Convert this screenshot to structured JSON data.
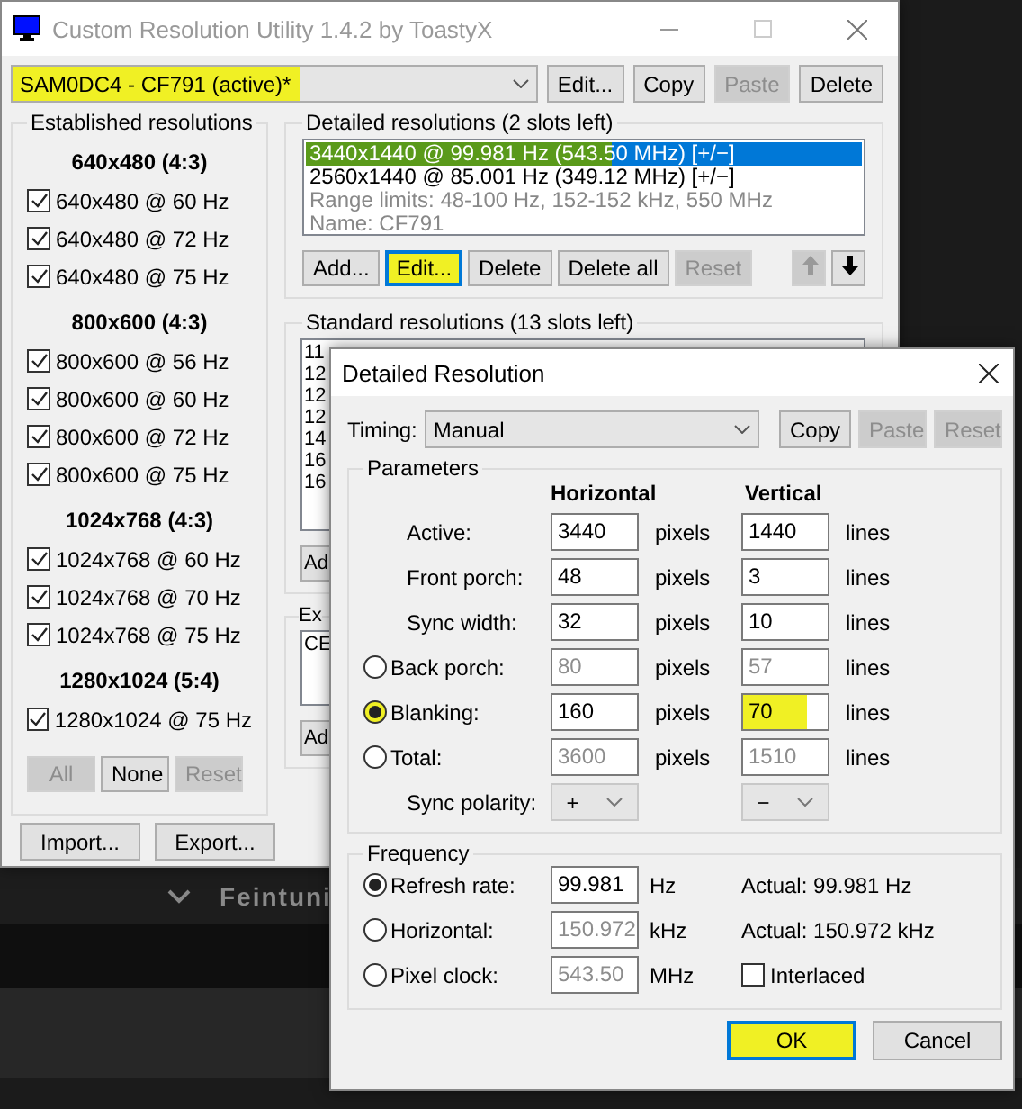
{
  "main_window": {
    "title": "Custom Resolution Utility 1.4.2 by ToastyX",
    "device": {
      "value": "SAM0DC4 - CF791 (active)*",
      "highlighted": true
    },
    "device_buttons": [
      {
        "label": "Edit...",
        "disabled": false
      },
      {
        "label": "Copy",
        "disabled": false
      },
      {
        "label": "Paste",
        "disabled": true
      },
      {
        "label": "Delete",
        "disabled": false
      }
    ],
    "established": {
      "title": "Established resolutions",
      "groups": [
        {
          "heading": "640x480 (4:3)",
          "items": [
            {
              "label": "640x480 @ 60 Hz",
              "checked": true
            },
            {
              "label": "640x480 @ 72 Hz",
              "checked": true
            },
            {
              "label": "640x480 @ 75 Hz",
              "checked": true
            }
          ]
        },
        {
          "heading": "800x600 (4:3)",
          "items": [
            {
              "label": "800x600 @ 56 Hz",
              "checked": true
            },
            {
              "label": "800x600 @ 60 Hz",
              "checked": true
            },
            {
              "label": "800x600 @ 72 Hz",
              "checked": true
            },
            {
              "label": "800x600 @ 75 Hz",
              "checked": true
            }
          ]
        },
        {
          "heading": "1024x768 (4:3)",
          "items": [
            {
              "label": "1024x768 @ 60 Hz",
              "checked": true
            },
            {
              "label": "1024x768 @ 70 Hz",
              "checked": true
            },
            {
              "label": "1024x768 @ 75 Hz",
              "checked": true
            }
          ]
        },
        {
          "heading": "1280x1024 (5:4)",
          "items": [
            {
              "label": "1280x1024 @ 75 Hz",
              "checked": true
            }
          ]
        }
      ],
      "buttons": [
        {
          "label": "All",
          "disabled": true
        },
        {
          "label": "None",
          "disabled": false
        },
        {
          "label": "Reset",
          "disabled": true
        }
      ]
    },
    "file_buttons": [
      {
        "label": "Import..."
      },
      {
        "label": "Export..."
      }
    ],
    "detailed": {
      "title": "Detailed resolutions (2 slots left)",
      "entries": [
        {
          "text": "3440x1440 @ 99.981 Hz (543.50 MHz) [+/−]",
          "kind": "resolution",
          "selected": true,
          "highlighted": true
        },
        {
          "text": "2560x1440 @ 85.001 Hz (349.12 MHz) [+/−]",
          "kind": "resolution",
          "selected": false,
          "highlighted": false
        },
        {
          "text": "Range limits: 48-100 Hz, 152-152 kHz, 550 MHz",
          "kind": "info",
          "selected": false,
          "highlighted": false
        },
        {
          "text": "Name: CF791",
          "kind": "info",
          "selected": false,
          "highlighted": false
        }
      ],
      "buttons": [
        {
          "label": "Add...",
          "disabled": false,
          "highlighted": false
        },
        {
          "label": "Edit...",
          "disabled": false,
          "highlighted": true
        },
        {
          "label": "Delete",
          "disabled": false,
          "highlighted": false
        },
        {
          "label": "Delete all",
          "disabled": false,
          "highlighted": false
        },
        {
          "label": "Reset",
          "disabled": true,
          "highlighted": false
        }
      ],
      "arrows": [
        {
          "kind": "up",
          "disabled": true
        },
        {
          "kind": "down",
          "disabled": false
        }
      ]
    },
    "standard": {
      "title": "Standard resolutions (13 slots left)",
      "entries": [
        "11",
        "12",
        "12",
        "12",
        "14",
        "16",
        "16"
      ],
      "button": "Ad"
    },
    "extension": {
      "title": "Ex",
      "entries": [
        "CE"
      ],
      "button": "Ad"
    }
  },
  "background": {
    "label": "Feintuni"
  },
  "dialog": {
    "title": "Detailed Resolution",
    "timing": {
      "label": "Timing:",
      "value": "Manual"
    },
    "timing_buttons": [
      {
        "label": "Copy",
        "disabled": false
      },
      {
        "label": "Paste",
        "disabled": true
      },
      {
        "label": "Reset",
        "disabled": true
      }
    ],
    "parameters": {
      "title": "Parameters",
      "headers": [
        "Horizontal",
        "Vertical"
      ],
      "rows": [
        {
          "kind": "plain",
          "label": "Active:",
          "horizontal": {
            "value": "3440",
            "disabled": false,
            "highlighted": false
          },
          "h_unit": "pixels",
          "vertical": {
            "value": "1440",
            "disabled": false,
            "highlighted": false
          },
          "v_unit": "lines"
        },
        {
          "kind": "plain",
          "label": "Front porch:",
          "horizontal": {
            "value": "48",
            "disabled": false,
            "highlighted": false
          },
          "h_unit": "pixels",
          "vertical": {
            "value": "3",
            "disabled": false,
            "highlighted": false
          },
          "v_unit": "lines"
        },
        {
          "kind": "plain",
          "label": "Sync width:",
          "horizontal": {
            "value": "32",
            "disabled": false,
            "highlighted": false
          },
          "h_unit": "pixels",
          "vertical": {
            "value": "10",
            "disabled": false,
            "highlighted": false
          },
          "v_unit": "lines"
        },
        {
          "kind": "radio",
          "label": "Back porch:",
          "selected": false,
          "highlighted": false,
          "horizontal": {
            "value": "80",
            "disabled": true,
            "highlighted": false
          },
          "h_unit": "pixels",
          "vertical": {
            "value": "57",
            "disabled": true,
            "highlighted": false
          },
          "v_unit": "lines"
        },
        {
          "kind": "radio",
          "label": "Blanking:",
          "selected": true,
          "highlighted": true,
          "horizontal": {
            "value": "160",
            "disabled": false,
            "highlighted": false
          },
          "h_unit": "pixels",
          "vertical": {
            "value": "70",
            "disabled": false,
            "highlighted": true
          },
          "v_unit": "lines"
        },
        {
          "kind": "radio",
          "label": "Total:",
          "selected": false,
          "highlighted": false,
          "horizontal": {
            "value": "3600",
            "disabled": true,
            "highlighted": false
          },
          "h_unit": "pixels",
          "vertical": {
            "value": "1510",
            "disabled": true,
            "highlighted": false
          },
          "v_unit": "lines"
        }
      ],
      "polarity": {
        "label": "Sync polarity:",
        "horizontal": "+",
        "vertical": "−"
      }
    },
    "frequency": {
      "title": "Frequency",
      "rows": [
        {
          "label": "Refresh rate:",
          "selected": true,
          "value": "99.981",
          "disabled": false,
          "unit": "Hz",
          "actual": "Actual: 99.981 Hz"
        },
        {
          "label": "Horizontal:",
          "selected": false,
          "value": "150.972",
          "disabled": true,
          "unit": "kHz",
          "actual": "Actual: 150.972 kHz"
        },
        {
          "label": "Pixel clock:",
          "selected": false,
          "value": "543.50",
          "disabled": true,
          "unit": "MHz"
        }
      ],
      "interlaced": {
        "label": "Interlaced",
        "checked": false
      }
    },
    "buttons": [
      {
        "label": "OK",
        "default": true,
        "highlighted": true
      },
      {
        "label": "Cancel",
        "default": false,
        "highlighted": false
      }
    ]
  }
}
